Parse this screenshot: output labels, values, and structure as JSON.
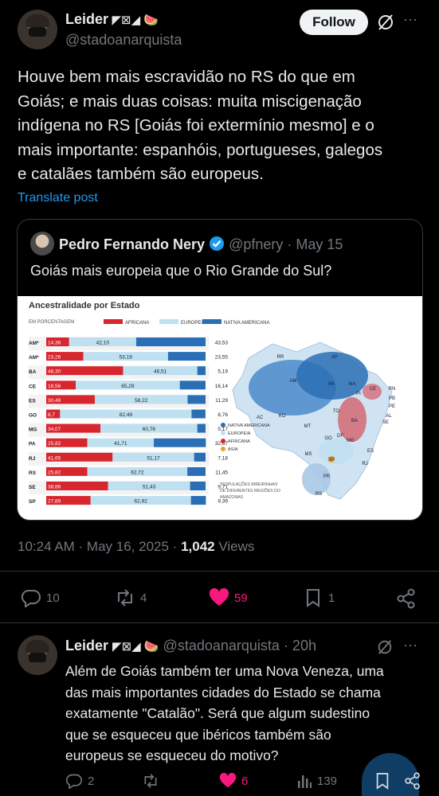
{
  "post": {
    "author_name": "Leider",
    "author_badges": "◤⊠◢ 🍉",
    "author_handle": "@stadoanarquista",
    "follow_label": "Follow",
    "more_label": "···",
    "text_lines": [
      "Houve bem mais escravidão no RS do que em",
      "Goiás; e mais duas coisas: muita miscigenação",
      "indígena no RS [Goiás foi extermínio mesmo] e o",
      "mais importante: espanhóis, portugueses, galegos",
      "e catalães também são europeus."
    ],
    "translate_label": "Translate post",
    "timestamp": "10:24 AM · May 16, 2025 · ",
    "views_count": "1,042",
    "views_label": " Views",
    "replies": "10",
    "reposts": "4",
    "likes": "59",
    "bookmarks": "1"
  },
  "quote": {
    "author_name": "Pedro Fernando Nery",
    "author_handle": "@pfnery",
    "date": "· May 15",
    "text": "Goiás mais europeia que o Rio Grande do Sul?"
  },
  "chart_data": {
    "type": "bar",
    "title": "Ancestralidade por Estado",
    "subtitle": "EM PORCENTAGEM",
    "categories": [
      "AM*",
      "AM*",
      "BA",
      "CE",
      "ES",
      "GO",
      "MG",
      "PA",
      "RJ",
      "RS",
      "SE",
      "SP"
    ],
    "series": [
      {
        "name": "AFRICANA",
        "color": "#d7262d",
        "values": [
          14.36,
          23.26,
          48.3,
          18.56,
          30.49,
          8.7,
          34.07,
          25.82,
          41.65,
          25.82,
          38.86,
          27.89
        ],
        "labels": [
          "14,36",
          "23,26",
          "48,30",
          "18,56",
          "30,49",
          "8,7",
          "34,07",
          "25,82",
          "41,65",
          "25,82",
          "38,86",
          "27,89"
        ]
      },
      {
        "name": "EUROPEIA",
        "color": "#bfe0f1",
        "values": [
          42.1,
          53.19,
          46.51,
          65.29,
          58.22,
          82.49,
          60.76,
          41.71,
          51.17,
          62.72,
          51.43,
          62.92
        ],
        "labels": [
          "42,10",
          "53,19",
          "46,51",
          "65,29",
          "58,22",
          "82,49",
          "60,76",
          "41,71",
          "51,17",
          "62,72",
          "51,43",
          "62,92"
        ]
      },
      {
        "name": "NATIVA AMERICANA",
        "color": "#2a6fb5",
        "values": [
          43.53,
          23.55,
          5.19,
          16.14,
          11.29,
          8.76,
          5.17,
          32.67,
          7.18,
          11.45,
          9.71,
          9.39
        ],
        "labels": [
          "43,53",
          "23,55",
          "5,19",
          "16,14",
          "11,29",
          "8,76",
          "5,17",
          "32,67",
          "7,18",
          "11,45",
          "9,71",
          "9,39"
        ]
      }
    ],
    "map_legend": [
      "NATIVA AMERICANA",
      "EUROPEIA",
      "AFRICANA",
      "ÁSIA"
    ],
    "map_legend_colors": [
      "#2a6fb5",
      "#bfe0f1",
      "#d7262d",
      "#f0a030"
    ],
    "map_footnote": [
      "*POPULAÇÕES RIBEIRINHAS",
      "DE DIFERENTES REGIÕES DO",
      "AMAZONAS"
    ],
    "map_labels": [
      "RR",
      "AP",
      "AM",
      "PA",
      "MA",
      "CE",
      "RN",
      "PB",
      "PE",
      "AL",
      "SE",
      "PI",
      "TO",
      "BA",
      "RO",
      "AC",
      "MT",
      "DF",
      "GO",
      "MG",
      "ES",
      "MS",
      "SP",
      "RJ",
      "PR",
      "RS"
    ]
  },
  "reply": {
    "author_name": "Leider",
    "author_badges": "◤⊠◢ 🍉",
    "author_handle": "@stadoanarquista",
    "time": "· 20h",
    "text_lines": [
      "Além de Goiás também ter uma Nova Veneza, uma",
      "das mais importantes cidades do Estado se chama",
      "exatamente \"Catalão\". Será que algum sudestino",
      "que se esqueceu que ibéricos também são",
      "europeus se esqueceu do motivo?"
    ],
    "replies": "2",
    "likes": "6",
    "views": "139"
  }
}
